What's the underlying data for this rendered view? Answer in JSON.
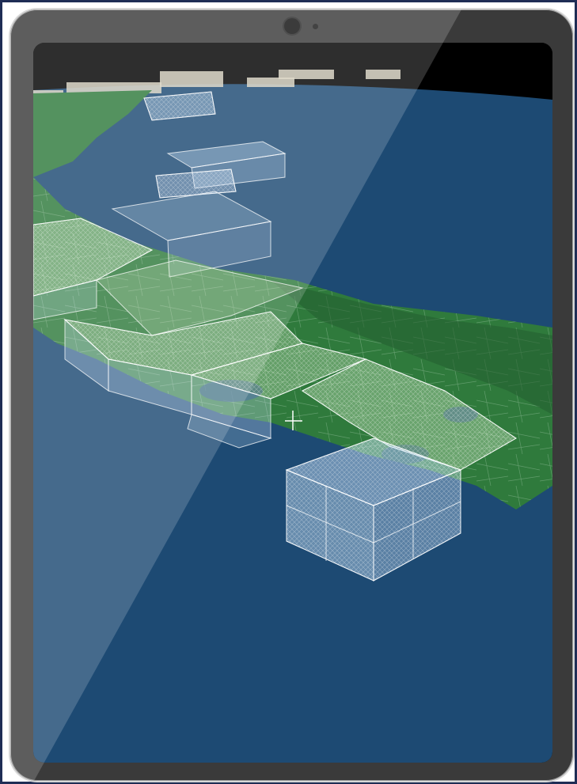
{
  "device": {
    "type": "tablet",
    "bezel_color": "#3a3a3a",
    "screen_background": "#000000"
  },
  "scene": {
    "view": "3d-globe",
    "ocean_color": "#1d4a73",
    "land_color": "#2f7a3c",
    "volume_color": "#cfe6ff",
    "grid_line_color": "#ffffff"
  },
  "icons": {
    "camera": "front-camera-icon",
    "sensor": "sensor-dot-icon"
  }
}
